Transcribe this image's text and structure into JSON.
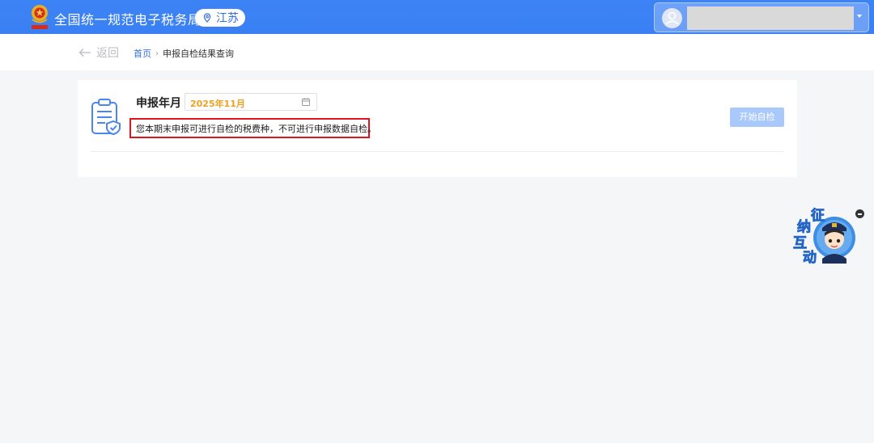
{
  "header": {
    "title": "全国统一规范电子税务局",
    "region": "江苏"
  },
  "breadcrumb": {
    "back_label": "返回",
    "home": "首页",
    "current": "申报自检结果查询"
  },
  "card": {
    "period_label": "申报年月",
    "period_value": "2025年11月",
    "notice": "您本期末申报可进行自检的税费种，不可进行申报数据自检。",
    "start_button": "开始自检"
  },
  "widget": {
    "chars": [
      "征",
      "纳",
      "互",
      "动"
    ]
  },
  "colors": {
    "header_blue": "#3b82f6",
    "link_blue": "#2f6ee6",
    "date_orange": "#f0a020",
    "notice_border_red": "#e0141f",
    "disabled_button": "#a9c8fb"
  }
}
